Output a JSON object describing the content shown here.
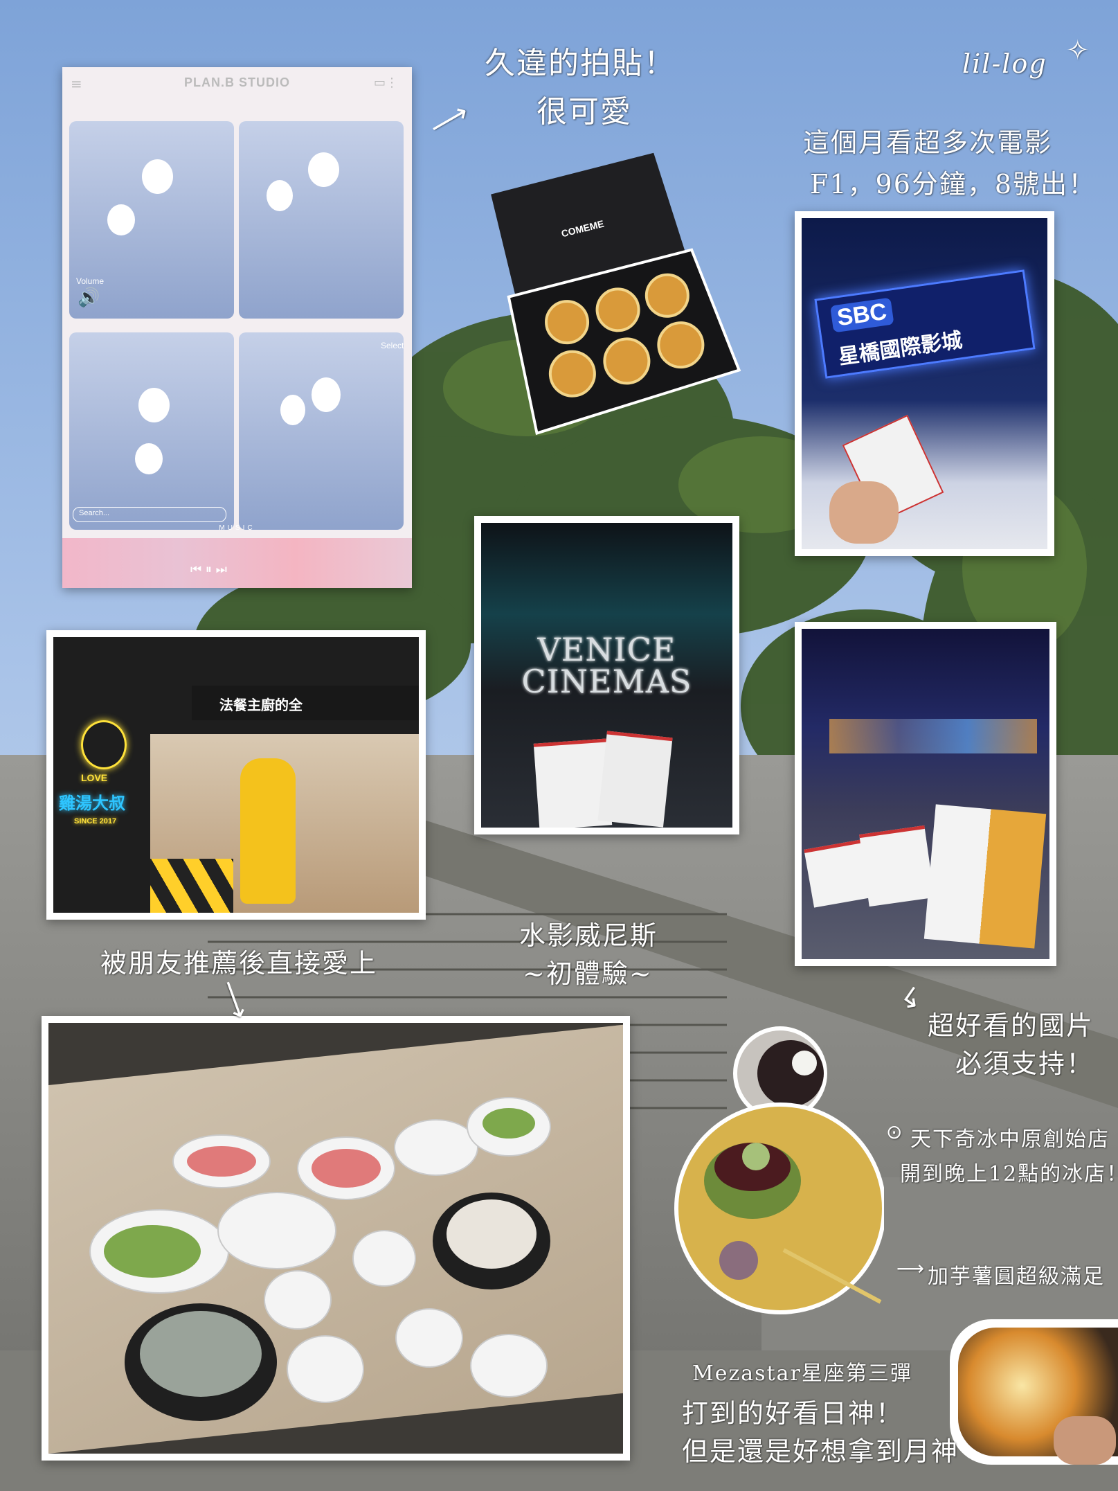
{
  "annotations": {
    "photobooth_note": [
      "久違的拍貼！",
      "很可愛"
    ],
    "signature": "lil-log",
    "movies_note": [
      "這個月看超多次電影",
      "F1，96分鐘，8號出！"
    ],
    "venice_note": [
      "水影威尼斯",
      "~初體驗~"
    ],
    "korean_movie_note": [
      "超好看的國片",
      "必須支持！"
    ],
    "hotpot_note": "被朋友推薦後直接愛上",
    "ice_shop_note": [
      "天下奇冰中原創始店",
      "開到晚上12點的冰店！"
    ],
    "taro_note": "加芋薯圓超級滿足",
    "mezastar_note": [
      "Mezastar星座第三彈",
      "打到的好看日神！",
      "但是還是好想拿到月神"
    ]
  },
  "photobooth": {
    "title": "PLAN.B STUDIO",
    "volume_label": "Volume",
    "select_label": "Select",
    "search_placeholder": "Search...",
    "music_label": "MUSIC"
  },
  "tart_box": {
    "brand": "COMEME"
  },
  "sbc": {
    "logo": "SBC",
    "name": "星橋國際影城"
  },
  "venice": {
    "line1": "VENICE",
    "line2": "CINEMAS"
  },
  "restaurant": {
    "sign": "法餐主廚的全",
    "neon_top": "LOVE",
    "neon_main": "雞湯大叔",
    "neon_since": "SINCE 2017"
  },
  "colors": {
    "sky_top": "#7ea3d8",
    "sky_bottom": "#c9d9ef",
    "tree": "#3d5a2a",
    "stone": "#8a8a86",
    "neon_blue": "#2ec5ff",
    "neon_yellow": "#ffe23a"
  }
}
